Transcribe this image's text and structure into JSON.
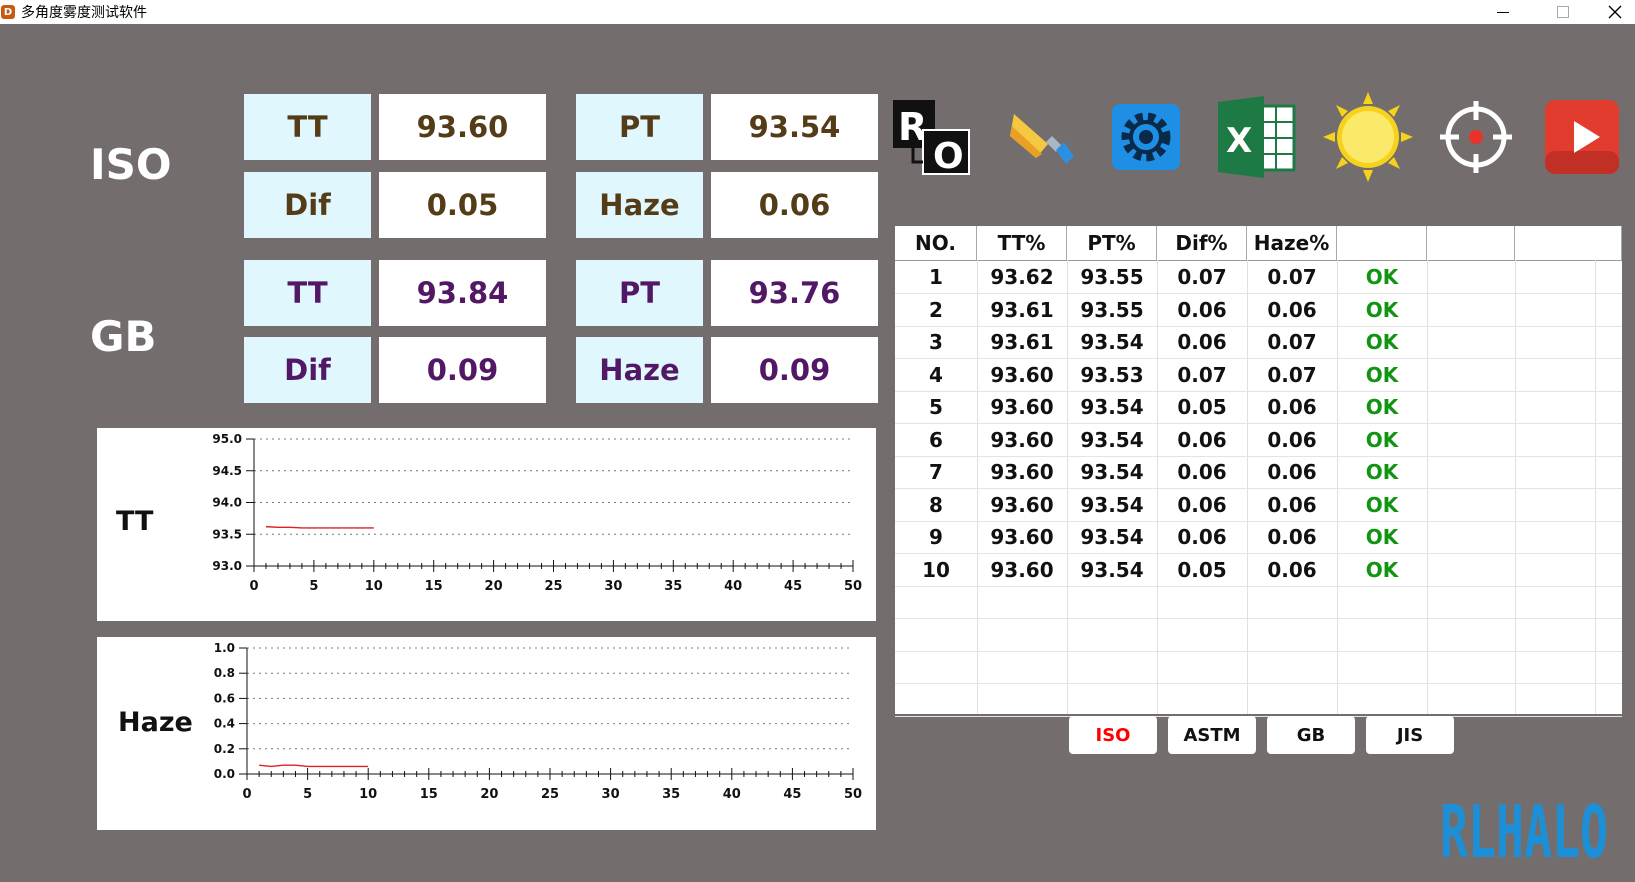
{
  "window": {
    "title": "多角度雾度测试软件",
    "app_icon_letter": "D"
  },
  "groups": {
    "iso_label": "ISO",
    "gb_label": "GB"
  },
  "iso": {
    "tt_label": "TT",
    "tt_value": "93.60",
    "pt_label": "PT",
    "pt_value": "93.54",
    "dif_label": "Dif",
    "dif_value": "0.05",
    "haze_label": "Haze",
    "haze_value": "0.06",
    "text_color": "#533c17"
  },
  "gb": {
    "tt_label": "TT",
    "tt_value": "93.84",
    "pt_label": "PT",
    "pt_value": "93.76",
    "dif_label": "Dif",
    "dif_value": "0.09",
    "haze_label": "Haze",
    "haze_value": "0.09",
    "text_color": "#521866"
  },
  "toolbar": {
    "icons": [
      "ro-icon",
      "brush-icon",
      "gear-icon",
      "excel-icon",
      "sun-icon",
      "target-icon",
      "play-icon"
    ]
  },
  "chart_data": [
    {
      "type": "line",
      "label": "TT",
      "xlim": [
        0,
        50
      ],
      "ylim": [
        93.0,
        95.0
      ],
      "xticks": [
        "0",
        "5",
        "10",
        "15",
        "20",
        "25",
        "30",
        "35",
        "40",
        "45",
        "50"
      ],
      "yticks": [
        "95.0",
        "94.5",
        "94.0",
        "93.5",
        "93.0"
      ],
      "grid": true,
      "x": [
        1,
        2,
        3,
        4,
        5,
        6,
        7,
        8,
        9,
        10
      ],
      "y": [
        93.62,
        93.61,
        93.61,
        93.6,
        93.6,
        93.6,
        93.6,
        93.6,
        93.6,
        93.6
      ]
    },
    {
      "type": "line",
      "label": "Haze",
      "xlim": [
        0,
        50
      ],
      "ylim": [
        0.0,
        1.0
      ],
      "xticks": [
        "0",
        "5",
        "10",
        "15",
        "20",
        "25",
        "30",
        "35",
        "40",
        "45",
        "50"
      ],
      "yticks": [
        "1.0",
        "0.8",
        "0.6",
        "0.4",
        "0.2",
        "0.0"
      ],
      "grid": true,
      "x": [
        1,
        2,
        3,
        4,
        5,
        6,
        7,
        8,
        9,
        10
      ],
      "y": [
        0.07,
        0.06,
        0.07,
        0.07,
        0.06,
        0.06,
        0.06,
        0.06,
        0.06,
        0.06
      ]
    }
  ],
  "table": {
    "headers": [
      "NO.",
      "TT%",
      "PT%",
      "Dif%",
      "Haze%",
      "",
      "",
      ""
    ],
    "rows": [
      [
        "1",
        "93.62",
        "93.55",
        "0.07",
        "0.07",
        "OK"
      ],
      [
        "2",
        "93.61",
        "93.55",
        "0.06",
        "0.06",
        "OK"
      ],
      [
        "3",
        "93.61",
        "93.54",
        "0.06",
        "0.07",
        "OK"
      ],
      [
        "4",
        "93.60",
        "93.53",
        "0.07",
        "0.07",
        "OK"
      ],
      [
        "5",
        "93.60",
        "93.54",
        "0.05",
        "0.06",
        "OK"
      ],
      [
        "6",
        "93.60",
        "93.54",
        "0.06",
        "0.06",
        "OK"
      ],
      [
        "7",
        "93.60",
        "93.54",
        "0.06",
        "0.06",
        "OK"
      ],
      [
        "8",
        "93.60",
        "93.54",
        "0.06",
        "0.06",
        "OK"
      ],
      [
        "9",
        "93.60",
        "93.54",
        "0.06",
        "0.06",
        "OK"
      ],
      [
        "10",
        "93.60",
        "93.54",
        "0.05",
        "0.06",
        "OK"
      ]
    ],
    "ok_color": "#119411"
  },
  "standards": {
    "buttons": [
      "ISO",
      "ASTM",
      "GB",
      "JIS"
    ],
    "active": "ISO",
    "active_color": "#ff0000"
  },
  "logo": {
    "text": "RLHALO",
    "color": "#1d8fd6"
  }
}
